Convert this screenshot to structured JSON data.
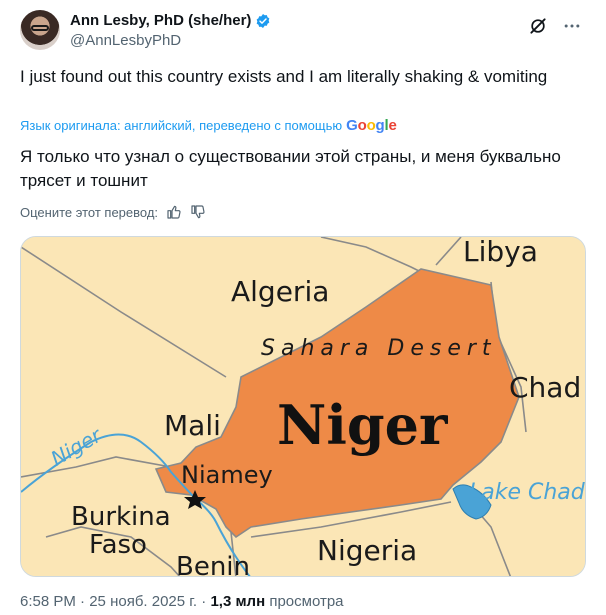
{
  "author": {
    "name": "Ann Lesby, PhD (she/her)",
    "handle": "@AnnLesbyPhD"
  },
  "tweet": {
    "text": "I just found out this country exists and I am literally shaking & vomiting"
  },
  "translation": {
    "source_note": "Язык оригинала: английский, переведено с помощью",
    "provider": "Google",
    "text_line1": "Я только что узнал о существовании этой страны, и меня буквально",
    "text_line2": "трясет и тошнит",
    "rate_label": "Оцените этот перевод:"
  },
  "map": {
    "labels": {
      "algeria": "Algeria",
      "libya": "Libya",
      "sahara": "Sahara Desert",
      "chad": "Chad",
      "mali": "Mali",
      "niger_country": "Niger",
      "niger_river": "Niger",
      "niamey": "Niamey",
      "lake_chad": "Lake Chad",
      "burkina": "Burkina",
      "faso": "Faso",
      "nigeria": "Nigeria",
      "benin": "Benin"
    },
    "colors": {
      "land": "#fbe6b6",
      "niger_fill": "#ee8a47",
      "border": "#8a8a8a",
      "water": "#4aa3d6"
    }
  },
  "footer": {
    "time": "6:58 PM",
    "date": "25 нояб. 2025 г.",
    "views_count": "1,3 млн",
    "views_label": "просмотра"
  },
  "icons": {
    "verified": "verified-badge-icon",
    "grok": "grok-icon",
    "more": "more-icon",
    "thumb_up": "thumb-up-icon",
    "thumb_down": "thumb-down-icon"
  }
}
